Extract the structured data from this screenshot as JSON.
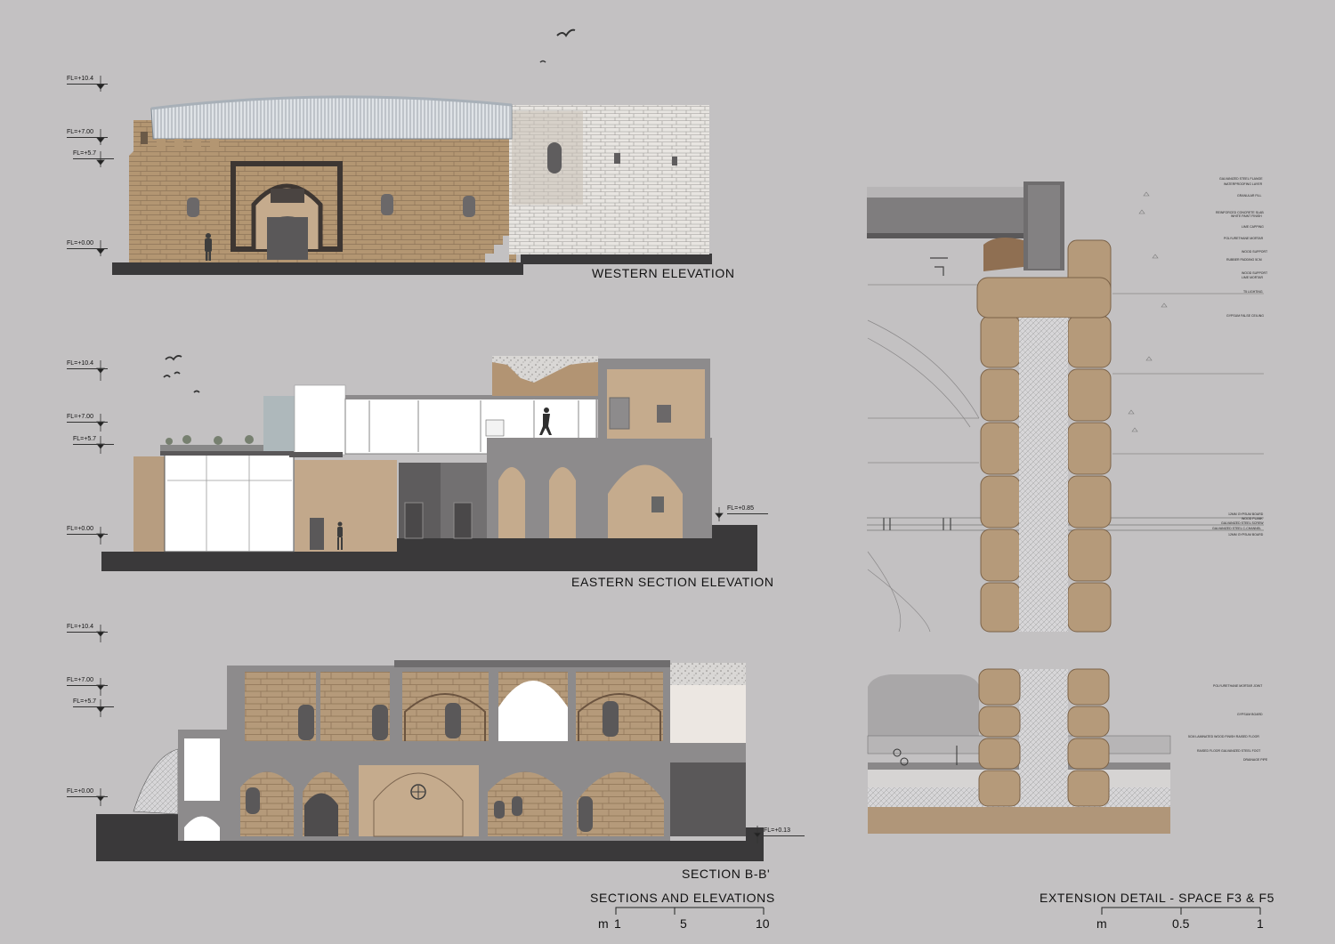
{
  "titles": {
    "western": "WESTERN ELEVATION",
    "eastern": "EASTERN SECTION ELEVATION",
    "section": "SECTION B-B'",
    "group_left": "SECTIONS AND ELEVATIONS",
    "group_right": "EXTENSION DETAIL - SPACE F3 & F5"
  },
  "levels": {
    "western": [
      "FL=+10.4",
      "FL=+7.00",
      "FL=+5.7",
      "FL=+0.00"
    ],
    "eastern": [
      "FL=+10.4",
      "FL=+7.00",
      "FL=+5.7",
      "FL=+0.00",
      "FL=+0.85"
    ],
    "section": [
      "FL=+10.4",
      "FL=+7.00",
      "FL=+5.7",
      "FL=+0.00",
      "FL=+0.13"
    ]
  },
  "scale_left": {
    "unit": "m",
    "ticks": [
      "1",
      "5",
      "10"
    ]
  },
  "scale_right": {
    "unit": "m",
    "ticks": [
      "0.5",
      "1"
    ]
  },
  "detail_labels_top": [
    "GALVANIZED STEEL FLANGE",
    "WATERPROOFING LAYER",
    "GRANULAR FILL",
    "REINFORCED CONCRETE SLAB",
    "WHITE PAINT FINISH",
    "LIME CAPPING",
    "POLYURETHANE MORTAR",
    "WOOD SUPPORT",
    "RUBBER PADDING 5CM",
    "WOOD SUPPORT",
    "LIME MORTAR",
    "T5 LIGHTING",
    "GYPSUM FALSE CEILING",
    "12MM GYPSUM BOARD",
    "WOOD PLANK",
    "GALVANIZED STEEL SCREW",
    "GALVANIZED STEEL C-CHANNEL",
    "12MM GYPSUM BOARD"
  ],
  "detail_labels_bottom": [
    "POLYURETHANE MORTAR JOINT",
    "GYPSUM BOARD",
    "5CM LAMINATED WOOD FINISH RAISED FLOOR",
    "RAISED FLOOR GALVANIZED STEEL FOOT",
    "DRAINAGE PIPE"
  ],
  "colors": {
    "background": "#c3c1c2",
    "stone": "#b39672",
    "stone_light": "#e6e3df",
    "plaster": "#c5ab8d",
    "grey_wall": "#8d8b8c",
    "dark_wall": "#666465",
    "ground": "#3a393a",
    "glass": "#ffffff"
  }
}
